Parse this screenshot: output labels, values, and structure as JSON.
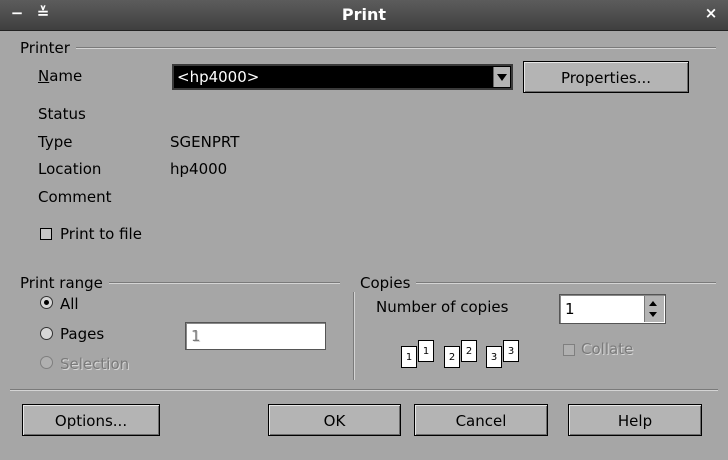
{
  "window": {
    "title": "Print",
    "minimize_glyph": "−",
    "maximize_glyph": "≚",
    "close_glyph": "×"
  },
  "printer": {
    "group_label": "Printer",
    "name_label": "Name",
    "name_value": "<hp4000>",
    "properties_label": "Properties...",
    "status_label": "Status",
    "status_value": "",
    "type_label": "Type",
    "type_value": "SGENPRT",
    "location_label": "Location",
    "location_value": "hp4000",
    "comment_label": "Comment",
    "comment_value": "",
    "print_to_file_label": "Print to file",
    "print_to_file_checked": false
  },
  "print_range": {
    "group_label": "Print range",
    "options": [
      {
        "label": "All",
        "selected": true,
        "enabled": true
      },
      {
        "label": "Pages",
        "selected": false,
        "enabled": true
      },
      {
        "label": "Selection",
        "selected": false,
        "enabled": false
      }
    ],
    "pages_value": "1"
  },
  "copies": {
    "group_label": "Copies",
    "number_label": "Number of copies",
    "number_value": "1",
    "collate_label": "Collate",
    "collate_enabled": false,
    "collate_icon_pages": [
      "1",
      "1",
      "2",
      "2",
      "3",
      "3"
    ]
  },
  "buttons": {
    "options": "Options...",
    "ok": "OK",
    "cancel": "Cancel",
    "help": "Help"
  }
}
